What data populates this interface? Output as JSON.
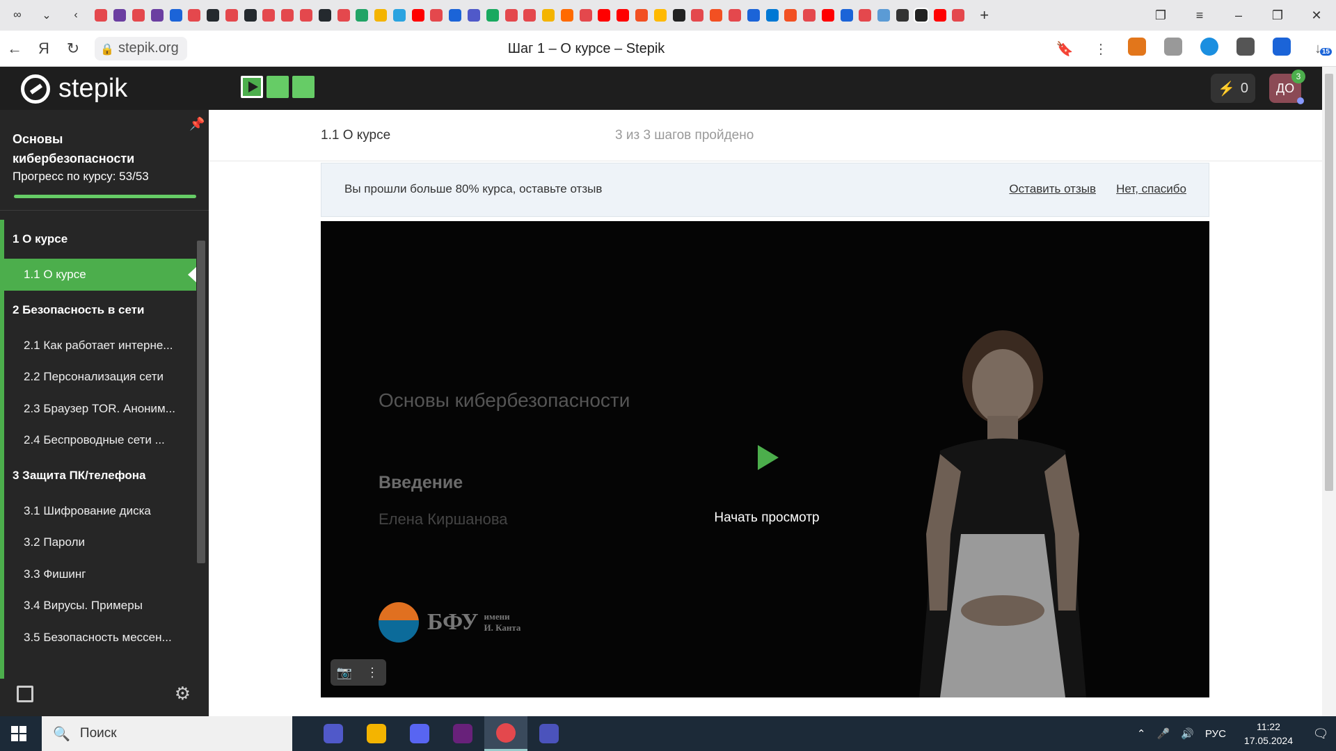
{
  "browser": {
    "url": "stepik.org",
    "page_title": "Шаг 1 – О курсе – Stepik",
    "tab_favicon_colors": [
      "#e4484d",
      "#6b3ea1",
      "#e4484d",
      "#6b3ea1",
      "#1b64d8",
      "#e4484d",
      "#24292e",
      "#e4484d",
      "#24292e",
      "#e4484d",
      "#e4484d",
      "#e4484d",
      "#24292e",
      "#e4484d",
      "#21a366",
      "#f4b400",
      "#2aa3e0",
      "#ff0000",
      "#e4484d",
      "#1b64d8",
      "#5059c9",
      "#19a960",
      "#e4484d",
      "#e4484d",
      "#f4b400",
      "#ff6a00",
      "#e4484d",
      "#ff0000",
      "#ff0000",
      "#f25022",
      "#ffb900",
      "#222222",
      "#e4484d",
      "#f25022",
      "#e4484d",
      "#1b64d8",
      "#0078d4",
      "#f25022",
      "#e4484d",
      "#ff0000",
      "#1b64d8",
      "#e4484d",
      "#5b9bd5",
      "#333333",
      "#222222",
      "#ff0000",
      "#e4484d"
    ],
    "extensions_badge": "15"
  },
  "header": {
    "logo_text": "stepik",
    "credits": "0",
    "avatar_initials": "ДО",
    "notifications": "3"
  },
  "sidebar": {
    "course_title": "Основы кибербезопасности",
    "progress_label": "Прогресс по курсу:  53/53",
    "progress_fraction": 1.0,
    "sections": [
      {
        "label": "1  О курсе",
        "items": [
          {
            "label": "1.1  О курсе",
            "active": true
          }
        ]
      },
      {
        "label": "2  Безопасность в сети",
        "items": [
          {
            "label": "2.1  Как работает интерне..."
          },
          {
            "label": "2.2  Персонализация сети"
          },
          {
            "label": "2.3  Браузер TOR. Аноним..."
          },
          {
            "label": "2.4  Беспроводные сети ..."
          }
        ]
      },
      {
        "label": "3  Защита ПК/телефона",
        "items": [
          {
            "label": "3.1  Шифрование диска"
          },
          {
            "label": "3.2  Пароли"
          },
          {
            "label": "3.3  Фишинг"
          },
          {
            "label": "3.4  Вирусы. Примеры"
          },
          {
            "label": "3.5  Безопасность мессен..."
          }
        ]
      }
    ]
  },
  "lesson": {
    "name": "1.1 О курсе",
    "progress": "3 из 3 шагов пройдено"
  },
  "review": {
    "text": "Вы прошли больше 80% курса, оставьте отзыв",
    "leave_label": "Оставить отзыв",
    "decline_label": "Нет, спасибо"
  },
  "video": {
    "title": "Основы кибербезопасности",
    "subtitle": "Введение",
    "author": "Елена Киршанова",
    "logo_main": "БФУ",
    "logo_sub_1": "имени",
    "logo_sub_2": "И. Канта",
    "play_label": "Начать просмотр"
  },
  "taskbar": {
    "search_label": "Поиск",
    "lang": "РУС",
    "time": "11:22",
    "date": "17.05.2024",
    "app_colors": [
      "#5059c9",
      "#f4b400",
      "#5865f2",
      "#68217a",
      "#e4484d",
      "#4b53bc"
    ]
  }
}
